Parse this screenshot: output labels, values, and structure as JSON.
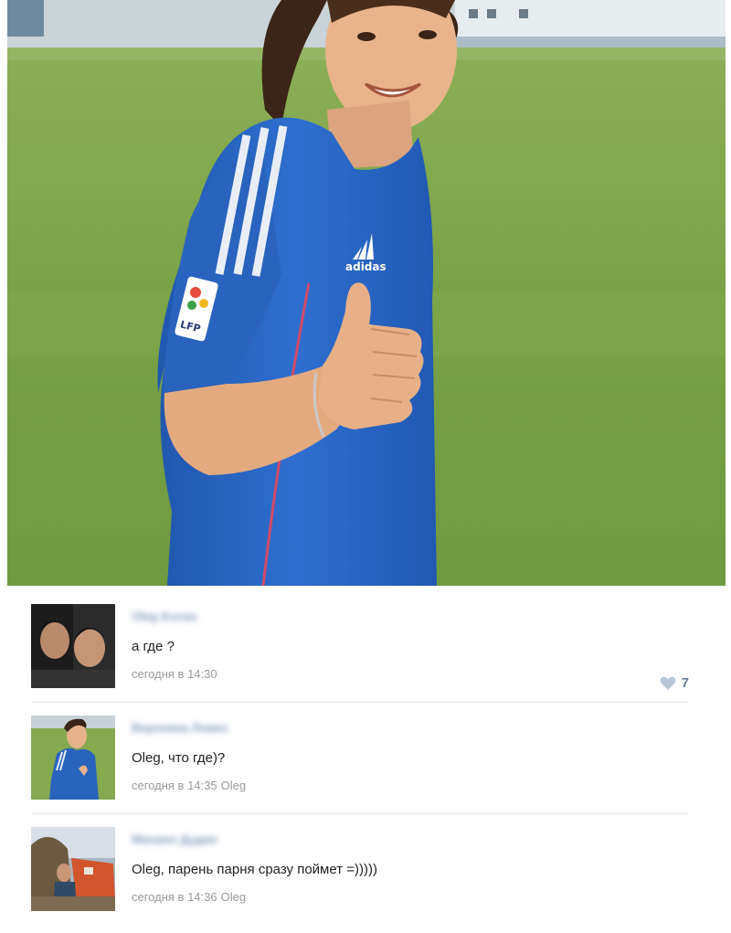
{
  "photo": {
    "jersey_brand": "adidas",
    "sleeve_badge": "LFP"
  },
  "comments": [
    {
      "author": "Oleg Kovas",
      "text": "а где ?",
      "time": "сегодня в 14:30",
      "reply_to": "",
      "likes": "7",
      "avatar_icon": "two-men-avatar"
    },
    {
      "author": "Вероника Ловиз",
      "text": "Oleg, что где)?",
      "time": "сегодня в 14:35",
      "reply_to": "Oleg",
      "avatar_icon": "girl-in-jersey-avatar"
    },
    {
      "author": "Михаил Дудин",
      "text": "Oleg, парень парня сразу поймет =)))))",
      "time": "сегодня в 14:36",
      "reply_to": "Oleg",
      "avatar_icon": "outdoor-man-avatar"
    }
  ],
  "colors": {
    "author_link": "#6a86ad",
    "meta_text": "#999999",
    "jersey_blue": "#2a66c2",
    "grass": "#7ea64a"
  }
}
